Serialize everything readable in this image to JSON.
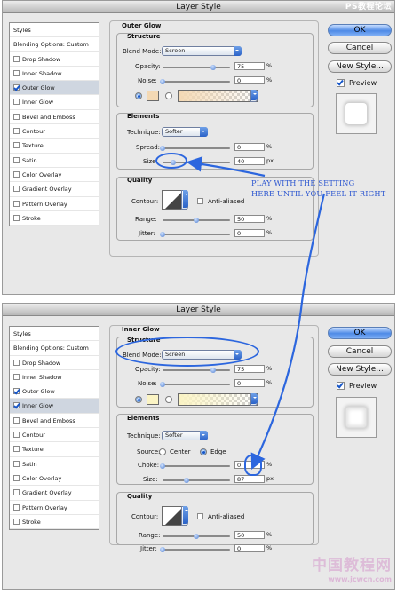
{
  "watermark_top": "PS教程论坛",
  "watermark_bottom": "中国教程网",
  "watermark_url": "www.jcwcn.com",
  "annotation": [
    "PLAY WITH THE SETTING",
    "HERE UNTIL YOU FEEL IT RIGHT"
  ],
  "accent_color": "#2c66de",
  "panel_top": {
    "window_title": "Layer Style",
    "sidebar": [
      {
        "label": "Styles",
        "checkbox": false,
        "checked": false,
        "selected": false
      },
      {
        "label": "Blending Options: Custom",
        "checkbox": false,
        "checked": false,
        "selected": false
      },
      {
        "label": "Drop Shadow",
        "checkbox": true,
        "checked": false,
        "selected": false
      },
      {
        "label": "Inner Shadow",
        "checkbox": true,
        "checked": false,
        "selected": false
      },
      {
        "label": "Outer Glow",
        "checkbox": true,
        "checked": true,
        "selected": true
      },
      {
        "label": "Inner Glow",
        "checkbox": true,
        "checked": false,
        "selected": false
      },
      {
        "label": "Bevel and Emboss",
        "checkbox": true,
        "checked": false,
        "selected": false
      },
      {
        "label": "Contour",
        "checkbox": true,
        "checked": false,
        "selected": false,
        "indent": true
      },
      {
        "label": "Texture",
        "checkbox": true,
        "checked": false,
        "selected": false,
        "indent": true
      },
      {
        "label": "Satin",
        "checkbox": true,
        "checked": false,
        "selected": false
      },
      {
        "label": "Color Overlay",
        "checkbox": true,
        "checked": false,
        "selected": false
      },
      {
        "label": "Gradient Overlay",
        "checkbox": true,
        "checked": false,
        "selected": false
      },
      {
        "label": "Pattern Overlay",
        "checkbox": true,
        "checked": false,
        "selected": false
      },
      {
        "label": "Stroke",
        "checkbox": true,
        "checked": false,
        "selected": false
      }
    ],
    "section_title": "Outer Glow",
    "structure": {
      "title": "Structure",
      "blend_mode_label": "Blend Mode:",
      "blend_mode": "Screen",
      "opacity_label": "Opacity:",
      "opacity": "75",
      "opacity_fraction": 0.75,
      "noise_label": "Noise:",
      "noise": "0",
      "noise_fraction": 0,
      "unit": "%",
      "glow_color": "#f4d9b4"
    },
    "elements": {
      "title": "Elements",
      "technique_label": "Technique:",
      "technique": "Softer",
      "spread_label": "Spread:",
      "spread": "0",
      "spread_fraction": 0,
      "size_label": "Size:",
      "size": "40",
      "size_fraction": 0.16,
      "unit_percent": "%",
      "unit_px": "px"
    },
    "quality": {
      "title": "Quality",
      "contour_label": "Contour:",
      "antialiased_label": "Anti-aliased",
      "range_label": "Range:",
      "range": "50",
      "range_fraction": 0.5,
      "jitter_label": "Jitter:",
      "jitter": "0",
      "jitter_fraction": 0,
      "unit": "%"
    },
    "buttons": {
      "ok": "OK",
      "cancel": "Cancel",
      "new_style": "New Style..."
    },
    "preview_label": "Preview",
    "preview_checked": true
  },
  "panel_bottom": {
    "window_title": "Layer Style",
    "sidebar": [
      {
        "label": "Styles",
        "checkbox": false,
        "checked": false,
        "selected": false
      },
      {
        "label": "Blending Options: Custom",
        "checkbox": false,
        "checked": false,
        "selected": false
      },
      {
        "label": "Drop Shadow",
        "checkbox": true,
        "checked": false,
        "selected": false
      },
      {
        "label": "Inner Shadow",
        "checkbox": true,
        "checked": false,
        "selected": false
      },
      {
        "label": "Outer Glow",
        "checkbox": true,
        "checked": true,
        "selected": false
      },
      {
        "label": "Inner Glow",
        "checkbox": true,
        "checked": true,
        "selected": true
      },
      {
        "label": "Bevel and Emboss",
        "checkbox": true,
        "checked": false,
        "selected": false
      },
      {
        "label": "Contour",
        "checkbox": true,
        "checked": false,
        "selected": false,
        "indent": true
      },
      {
        "label": "Texture",
        "checkbox": true,
        "checked": false,
        "selected": false,
        "indent": true
      },
      {
        "label": "Satin",
        "checkbox": true,
        "checked": false,
        "selected": false
      },
      {
        "label": "Color Overlay",
        "checkbox": true,
        "checked": false,
        "selected": false
      },
      {
        "label": "Gradient Overlay",
        "checkbox": true,
        "checked": false,
        "selected": false
      },
      {
        "label": "Pattern Overlay",
        "checkbox": true,
        "checked": false,
        "selected": false
      },
      {
        "label": "Stroke",
        "checkbox": true,
        "checked": false,
        "selected": false
      }
    ],
    "section_title": "Inner Glow",
    "structure": {
      "title": "Structure",
      "blend_mode_label": "Blend Mode:",
      "blend_mode": "Screen",
      "opacity_label": "Opacity:",
      "opacity": "75",
      "opacity_fraction": 0.75,
      "noise_label": "Noise:",
      "noise": "0",
      "noise_fraction": 0,
      "unit": "%",
      "glow_color": "#fbf4c4"
    },
    "elements": {
      "title": "Elements",
      "technique_label": "Technique:",
      "technique": "Softer",
      "source_label": "Source:",
      "source_center": "Center",
      "source_edge": "Edge",
      "choke_label": "Choke:",
      "choke": "0",
      "choke_fraction": 0,
      "size_label": "Size:",
      "size": "87",
      "size_fraction": 0.35,
      "unit_percent": "%",
      "unit_px": "px"
    },
    "quality": {
      "title": "Quality",
      "contour_label": "Contour:",
      "antialiased_label": "Anti-aliased",
      "range_label": "Range:",
      "range": "50",
      "range_fraction": 0.5,
      "jitter_label": "Jitter:",
      "jitter": "0",
      "jitter_fraction": 0,
      "unit": "%"
    },
    "buttons": {
      "ok": "OK",
      "cancel": "Cancel",
      "new_style": "New Style..."
    },
    "preview_label": "Preview",
    "preview_checked": true
  }
}
